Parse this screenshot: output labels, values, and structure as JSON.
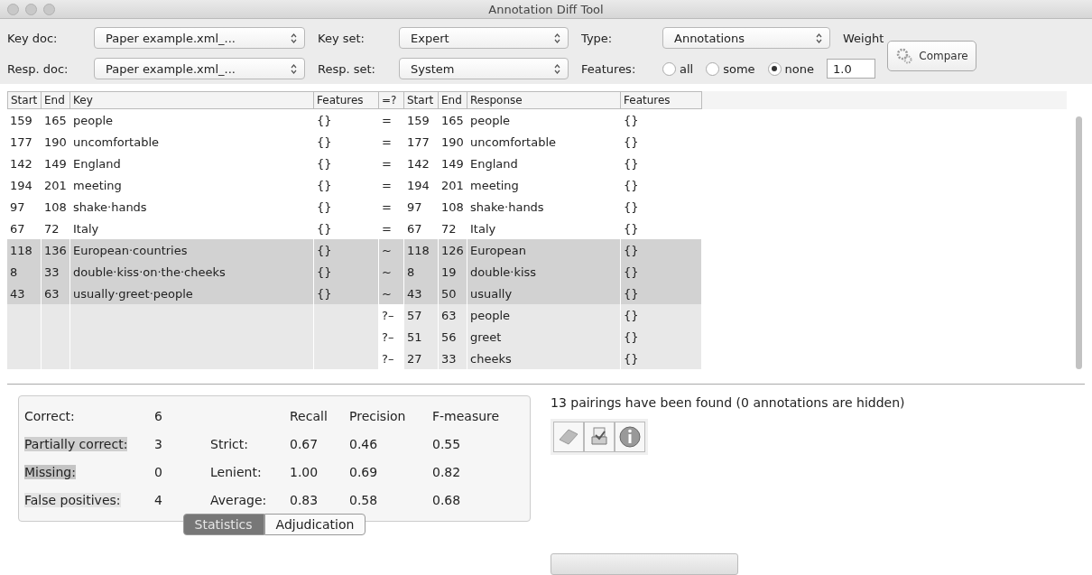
{
  "window": {
    "title": "Annotation Diff Tool"
  },
  "controls": {
    "key_doc": {
      "label": "Key doc:",
      "value": "Paper example.xml_..."
    },
    "key_set": {
      "label": "Key set:",
      "value": "Expert"
    },
    "type": {
      "label": "Type:",
      "value": "Annotations"
    },
    "weight": {
      "label": "Weight",
      "value": "1.0"
    },
    "resp_doc": {
      "label": "Resp. doc:",
      "value": "Paper example.xml_..."
    },
    "resp_set": {
      "label": "Resp. set:",
      "value": "System"
    },
    "features": {
      "label": "Features:",
      "options": [
        {
          "label": "all",
          "selected": false
        },
        {
          "label": "some",
          "selected": false
        },
        {
          "label": "none",
          "selected": true
        }
      ]
    },
    "compare_button": "Compare"
  },
  "table": {
    "columns": [
      "Start",
      "End",
      "Key",
      "Features",
      "=?",
      "Start",
      "End",
      "Response",
      "Features"
    ],
    "rows": [
      {
        "kind": "correct",
        "cells": [
          "159",
          "165",
          "people",
          "{}",
          "=",
          "159",
          "165",
          "people",
          "{}"
        ]
      },
      {
        "kind": "correct",
        "cells": [
          "177",
          "190",
          "uncomfortable",
          "{}",
          "=",
          "177",
          "190",
          "uncomfortable",
          "{}"
        ]
      },
      {
        "kind": "correct",
        "cells": [
          "142",
          "149",
          "England",
          "{}",
          "=",
          "142",
          "149",
          "England",
          "{}"
        ]
      },
      {
        "kind": "correct",
        "cells": [
          "194",
          "201",
          "meeting",
          "{}",
          "=",
          "194",
          "201",
          "meeting",
          "{}"
        ]
      },
      {
        "kind": "correct",
        "cells": [
          "97",
          "108",
          "shake·hands",
          "{}",
          "=",
          "97",
          "108",
          "shake·hands",
          "{}"
        ]
      },
      {
        "kind": "correct",
        "cells": [
          "67",
          "72",
          "Italy",
          "{}",
          "=",
          "67",
          "72",
          "Italy",
          "{}"
        ]
      },
      {
        "kind": "partial",
        "cells": [
          "118",
          "136",
          "European·countries",
          "{}",
          "~",
          "118",
          "126",
          "European",
          "{}"
        ]
      },
      {
        "kind": "partial",
        "cells": [
          "8",
          "33",
          "double·kiss·on·the·cheeks",
          "{}",
          "~",
          "8",
          "19",
          "double·kiss",
          "{}"
        ]
      },
      {
        "kind": "partial",
        "cells": [
          "43",
          "63",
          "usually·greet·people",
          "{}",
          "~",
          "43",
          "50",
          "usually",
          "{}"
        ]
      },
      {
        "kind": "spurious",
        "cells": [
          "",
          "",
          "",
          "",
          "?–",
          "57",
          "63",
          "people",
          "{}"
        ]
      },
      {
        "kind": "spurious",
        "cells": [
          "",
          "",
          "",
          "",
          "?–",
          "51",
          "56",
          "greet",
          "{}"
        ]
      },
      {
        "kind": "spurious",
        "cells": [
          "",
          "",
          "",
          "",
          "?–",
          "27",
          "33",
          "cheeks",
          "{}"
        ]
      }
    ]
  },
  "statistics": {
    "counts": [
      {
        "kind": "correct",
        "label": "Correct:",
        "value": "6"
      },
      {
        "kind": "partial",
        "label": "Partially correct:",
        "value": "3"
      },
      {
        "kind": "missing",
        "label": "Missing:",
        "value": "0"
      },
      {
        "kind": "spurious",
        "label": "False positives:",
        "value": "4"
      }
    ],
    "measure_headers": [
      "Recall",
      "Precision",
      "F-measure"
    ],
    "measures": [
      {
        "label": "Strict:",
        "values": [
          "0.67",
          "0.46",
          "0.55"
        ]
      },
      {
        "label": "Lenient:",
        "values": [
          "1.00",
          "0.69",
          "0.82"
        ]
      },
      {
        "label": "Average:",
        "values": [
          "0.83",
          "0.58",
          "0.68"
        ]
      }
    ]
  },
  "tabs": [
    {
      "label": "Statistics",
      "selected": true
    },
    {
      "label": "Adjudication",
      "selected": false
    }
  ],
  "status_message": "13 pairings have been found (0 annotations are hidden)",
  "progress": {
    "level": 0
  }
}
